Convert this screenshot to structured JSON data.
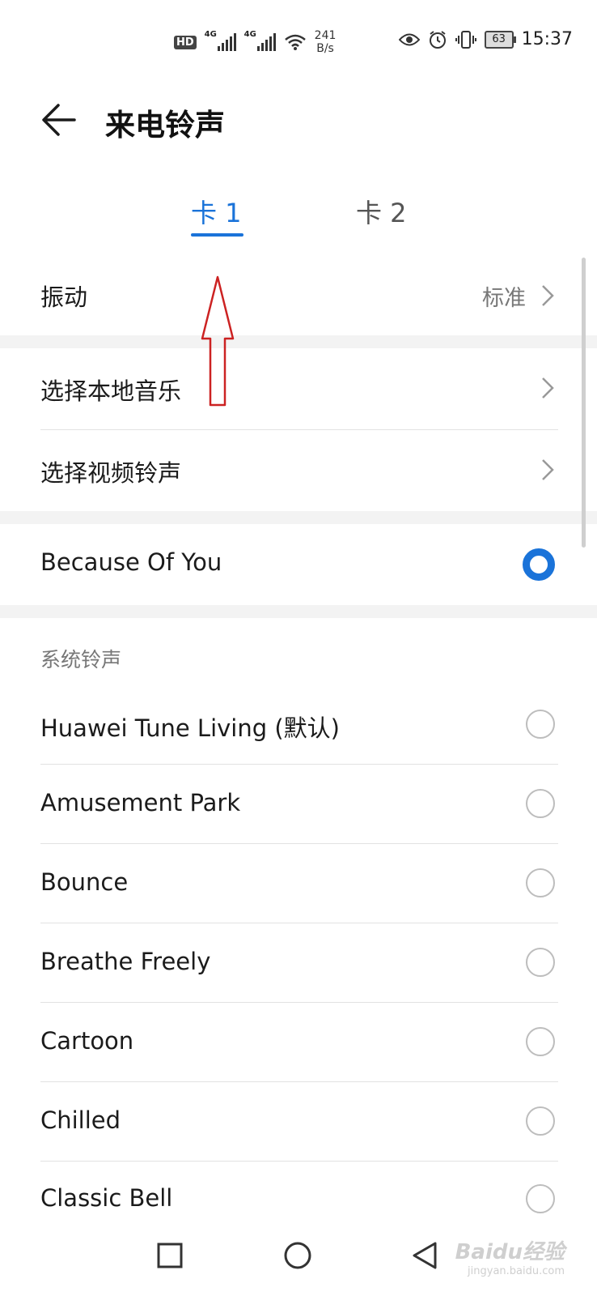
{
  "status_bar": {
    "hd": "HD",
    "network1": "4G",
    "network2": "4G",
    "speed_value": "241",
    "speed_unit": "B/s",
    "battery": "63",
    "time": "15:37"
  },
  "header": {
    "title": "来电铃声"
  },
  "tabs": [
    {
      "label": "卡 1",
      "active": true
    },
    {
      "label": "卡 2",
      "active": false
    }
  ],
  "vibration": {
    "label": "振动",
    "value": "标准"
  },
  "options": [
    {
      "label": "选择本地音乐"
    },
    {
      "label": "选择视频铃声"
    }
  ],
  "current": {
    "label": "Because Of You",
    "selected": true
  },
  "system": {
    "header": "系统铃声",
    "items": [
      {
        "label": "Huawei Tune Living (默认)"
      },
      {
        "label": "Amusement Park"
      },
      {
        "label": "Bounce"
      },
      {
        "label": "Breathe Freely"
      },
      {
        "label": "Cartoon"
      },
      {
        "label": "Chilled"
      },
      {
        "label": "Classic Bell"
      }
    ]
  },
  "watermark": {
    "brand": "Baidu经验",
    "site": "jingyan.baidu.com"
  },
  "colors": {
    "accent": "#1a73d9",
    "annotation": "#cc2222"
  }
}
